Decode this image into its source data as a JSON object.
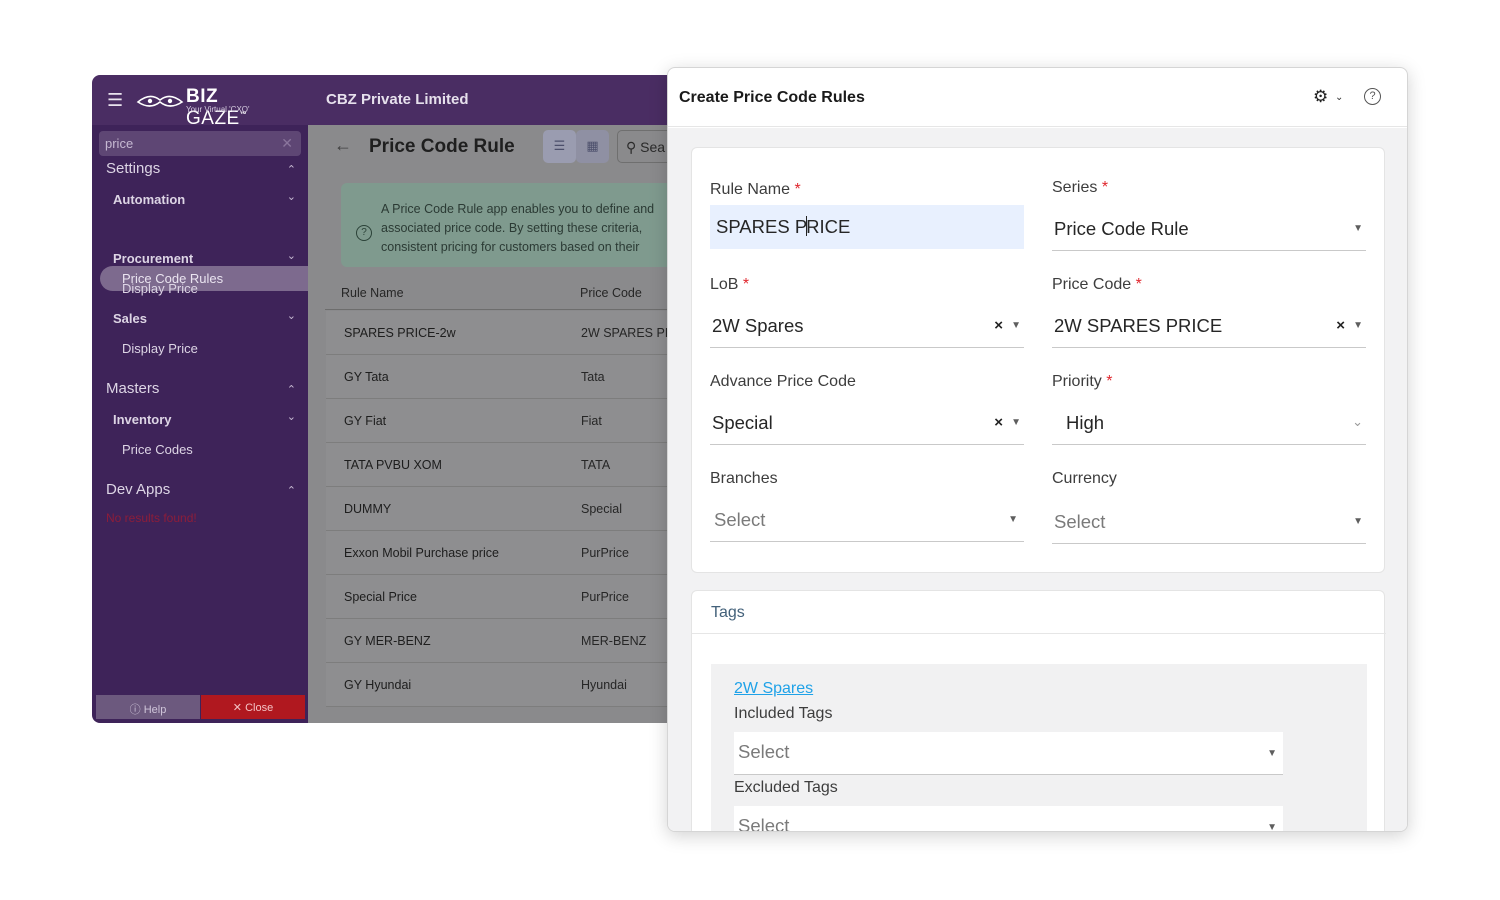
{
  "app": {
    "brand": "BIZ GAZE",
    "brand_bold": "BIZ",
    "brand_thin": "GAZE",
    "tm": "™",
    "tagline": "Your Virtual 'CXO'",
    "company": "CBZ Private Limited"
  },
  "sidebar": {
    "search_value": "price",
    "sections": [
      {
        "label": "Settings"
      },
      {
        "label": "Masters"
      },
      {
        "label": "Dev Apps"
      }
    ],
    "items": {
      "automation": "Automation",
      "price_code_rules": "Price Code Rules",
      "procurement": "Procurement",
      "display_price_1": "Display Price",
      "sales": "Sales",
      "display_price_2": "Display Price",
      "inventory": "Inventory",
      "price_codes": "Price Codes"
    },
    "no_results": "No results found!",
    "help": "Help",
    "close": "Close"
  },
  "main": {
    "title": "Price Code Rule",
    "search_placeholder": "Sea",
    "banner_lines": [
      "A Price Code Rule app enables you to define and",
      "associated price code. By setting these criteria,",
      "consistent pricing for customers based on their"
    ],
    "columns": [
      "Rule Name",
      "Price Code"
    ],
    "rows": [
      [
        "SPARES PRICE-2w",
        "2W SPARES PR"
      ],
      [
        "GY Tata",
        "Tata"
      ],
      [
        "GY Fiat",
        "Fiat"
      ],
      [
        "TATA PVBU XOM",
        "TATA"
      ],
      [
        "DUMMY",
        "Special"
      ],
      [
        "Exxon Mobil Purchase price",
        "PurPrice"
      ],
      [
        "Special Price",
        "PurPrice"
      ],
      [
        "GY MER-BENZ",
        "MER-BENZ"
      ],
      [
        "GY Hyundai",
        "Hyundai"
      ]
    ]
  },
  "modal": {
    "title": "Create Price Code Rules",
    "fields": {
      "rule_name": {
        "label": "Rule Name",
        "value_before_cursor": "SPARES P",
        "value_after_cursor": "RICE"
      },
      "series": {
        "label": "Series",
        "value": "Price Code Rule"
      },
      "lob": {
        "label": "LoB",
        "value": "2W Spares"
      },
      "price_code": {
        "label": "Price Code",
        "value": "2W SPARES PRICE"
      },
      "advance_price_code": {
        "label": "Advance Price Code",
        "value": "Special"
      },
      "priority": {
        "label": "Priority",
        "value": "High"
      },
      "branches": {
        "label": "Branches",
        "placeholder": "Select"
      },
      "currency": {
        "label": "Currency",
        "placeholder": "Select"
      }
    },
    "required_mark": "*",
    "clear_mark": "×",
    "tags": {
      "title": "Tags",
      "group_link": "2W Spares",
      "included_label": "Included Tags",
      "included_placeholder": "Select",
      "excluded_label": "Excluded Tags",
      "excluded_placeholder": "Select"
    }
  },
  "icons": {
    "hamburger": "menu-icon",
    "back": "arrow-left-icon",
    "list_view": "list-view-icon",
    "grid_view": "grid-view-icon",
    "search": "search-icon",
    "gear": "gear-icon",
    "help": "help-icon",
    "dropdown": "chevron-down-icon",
    "clear": "close-icon"
  },
  "colors": {
    "sidebar_bg": "#3e2359",
    "topbar_bg": "#4a2d63",
    "close_red": "#b0181f",
    "required": "#e0262d",
    "link": "#1fa2e8",
    "active_field": "#e8f0fe"
  }
}
